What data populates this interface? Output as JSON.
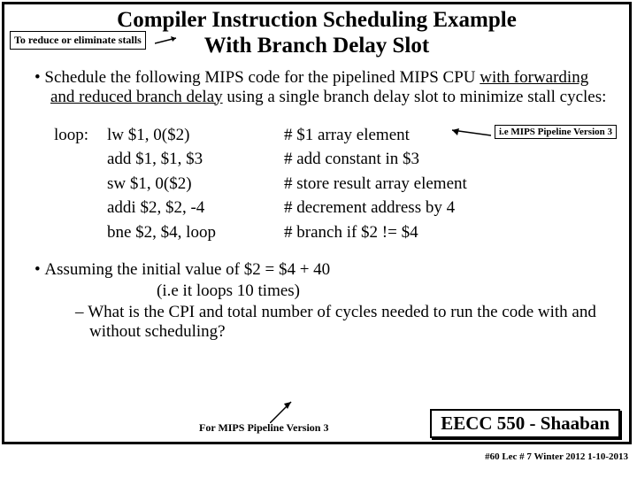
{
  "annot1": "To reduce or eliminate stalls",
  "title_l1": "Compiler Instruction Scheduling Example",
  "title_l2": "With Branch Delay Slot",
  "para1_a": "Schedule the following MIPS code for the pipelined MIPS CPU ",
  "para1_u": "with forwarding and reduced branch delay",
  "para1_b": " using a single branch delay slot to minimize stall cycles:",
  "annot2": "i.e MIPS Pipeline Version 3",
  "loop_label": "loop:",
  "code": [
    {
      "ins": "lw $1, 0($2)",
      "cmt": "#  $1 array element"
    },
    {
      "ins": "add $1, $1, $3",
      "cmt": "# add constant in $3"
    },
    {
      "ins": "sw $1, 0($2)",
      "cmt": "# store result array element"
    },
    {
      "ins": "addi $2, $2, -4",
      "cmt": "# decrement address by 4"
    },
    {
      "ins": "bne $2, $4, loop",
      "cmt": "# branch if $2 != $4"
    }
  ],
  "para2": "Assuming the initial value of   $2  =  $4 +  40",
  "para2_sub": "(i.e it loops 10 times)",
  "para2_q": "What is the CPI and total number of cycles needed to run the code with and without scheduling?",
  "annot3": "For MIPS Pipeline Version 3",
  "course": "EECC 550 - Shaaban",
  "footer": "#60   Lec # 7  Winter 2012  1-10-2013"
}
